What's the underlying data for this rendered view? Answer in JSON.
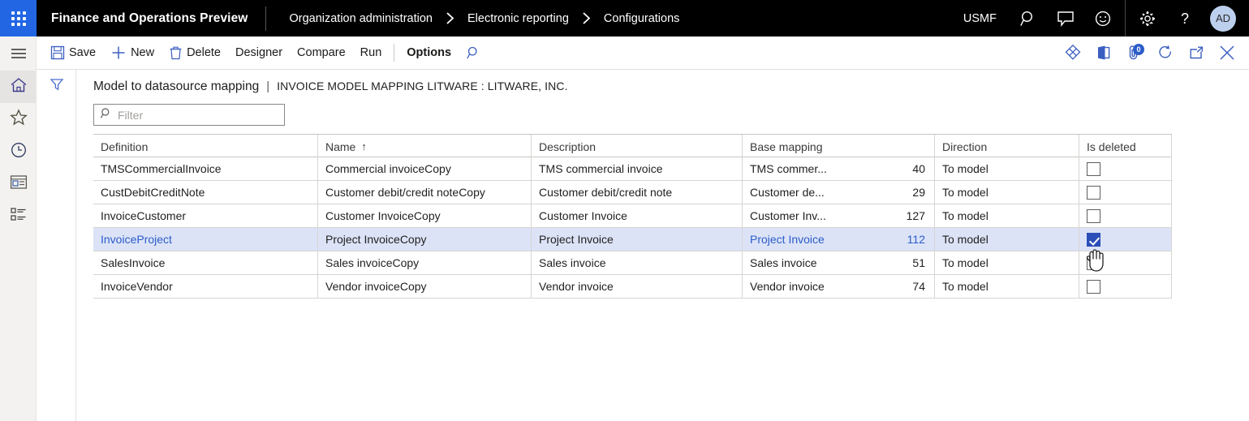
{
  "topbar": {
    "waffle_icon": "app-launcher-icon",
    "app_title": "Finance and Operations Preview",
    "breadcrumb": [
      {
        "label": "Organization administration"
      },
      {
        "label": "Electronic reporting"
      },
      {
        "label": "Configurations"
      }
    ],
    "breadcrumb_separator": "›",
    "company": "USMF",
    "icons": [
      {
        "name": "search-icon"
      },
      {
        "name": "message-icon"
      },
      {
        "name": "feedback-smiley-icon"
      },
      {
        "name": "settings-gear-icon"
      },
      {
        "name": "help-question-icon"
      }
    ],
    "avatar_initials": "AD",
    "accent_color": "#2266e3",
    "background_color": "#000000"
  },
  "leftrail": {
    "items": [
      {
        "name": "hamburger-menu-icon",
        "label": "Expand navigation"
      },
      {
        "name": "home-icon",
        "label": "Home",
        "active": true
      },
      {
        "name": "favorites-star-icon",
        "label": "Favorites"
      },
      {
        "name": "recent-clock-icon",
        "label": "Recent"
      },
      {
        "name": "workspaces-icon",
        "label": "Workspaces"
      },
      {
        "name": "modules-list-icon",
        "label": "Modules"
      }
    ]
  },
  "actionpane": {
    "commands": [
      {
        "label": "Save",
        "icon": "save-disk-icon",
        "bold": false
      },
      {
        "label": "New",
        "icon": "plus-icon",
        "bold": false
      },
      {
        "label": "Delete",
        "icon": "trash-icon",
        "bold": false
      },
      {
        "label": "Designer",
        "icon": "",
        "bold": false
      },
      {
        "label": "Compare",
        "icon": "",
        "bold": false
      },
      {
        "label": "Run",
        "icon": "",
        "bold": false
      },
      {
        "label": "Options",
        "icon": "",
        "bold": true
      }
    ],
    "search_icon": "search-icon",
    "right_icons": [
      {
        "name": "personalize-diamond-icon"
      },
      {
        "name": "office-export-icon"
      },
      {
        "name": "attachments-icon",
        "badge": "0"
      },
      {
        "name": "refresh-icon"
      },
      {
        "name": "open-in-new-window-icon"
      },
      {
        "name": "close-icon"
      }
    ]
  },
  "filterrail": {
    "funnel_icon": "filter-funnel-icon"
  },
  "page": {
    "title": "Model to datasource mapping",
    "pipe": "|",
    "subtitle": "INVOICE MODEL MAPPING LITWARE : LITWARE, INC."
  },
  "filter": {
    "icon": "search-icon",
    "value": "",
    "placeholder": "Filter"
  },
  "grid": {
    "columns": [
      {
        "label": "Definition",
        "sorted": false
      },
      {
        "label": "Name",
        "sorted": true,
        "sort_arrow": "↑"
      },
      {
        "label": "Description",
        "sorted": false
      },
      {
        "label": "Base mapping",
        "sorted": false
      },
      {
        "label": "Direction",
        "sorted": false
      },
      {
        "label": "Is deleted",
        "sorted": false
      }
    ],
    "rows": [
      {
        "definition": "TMSCommercialInvoice",
        "name": "Commercial invoiceCopy",
        "description": "TMS commercial invoice",
        "base_mapping_label": "TMS commer...",
        "base_mapping_count": "40",
        "direction": "To model",
        "is_deleted": false,
        "selected": false
      },
      {
        "definition": "CustDebitCreditNote",
        "name": "Customer debit/credit noteCopy",
        "description": "Customer debit/credit note",
        "base_mapping_label": "Customer de...",
        "base_mapping_count": "29",
        "direction": "To model",
        "is_deleted": false,
        "selected": false
      },
      {
        "definition": "InvoiceCustomer",
        "name": "Customer InvoiceCopy",
        "description": "Customer Invoice",
        "base_mapping_label": "Customer Inv...",
        "base_mapping_count": "127",
        "direction": "To model",
        "is_deleted": false,
        "selected": false
      },
      {
        "definition": "InvoiceProject",
        "name": "Project InvoiceCopy",
        "description": "Project Invoice",
        "base_mapping_label": "Project Invoice",
        "base_mapping_count": "112",
        "direction": "To model",
        "is_deleted": true,
        "selected": true
      },
      {
        "definition": "SalesInvoice",
        "name": "Sales invoiceCopy",
        "description": "Sales invoice",
        "base_mapping_label": "Sales invoice",
        "base_mapping_count": "51",
        "direction": "To model",
        "is_deleted": false,
        "selected": false
      },
      {
        "definition": "InvoiceVendor",
        "name": "Vendor invoiceCopy",
        "description": "Vendor invoice",
        "base_mapping_label": "Vendor invoice",
        "base_mapping_count": "74",
        "direction": "To model",
        "is_deleted": false,
        "selected": false
      }
    ]
  },
  "cursor": {
    "name": "hand-pointer-cursor"
  },
  "colors": {
    "selection_row": "#dce3f7",
    "checkbox_checked": "#2b4fb8",
    "link": "#2b5cc8",
    "rail_background": "#f3f2f1"
  }
}
